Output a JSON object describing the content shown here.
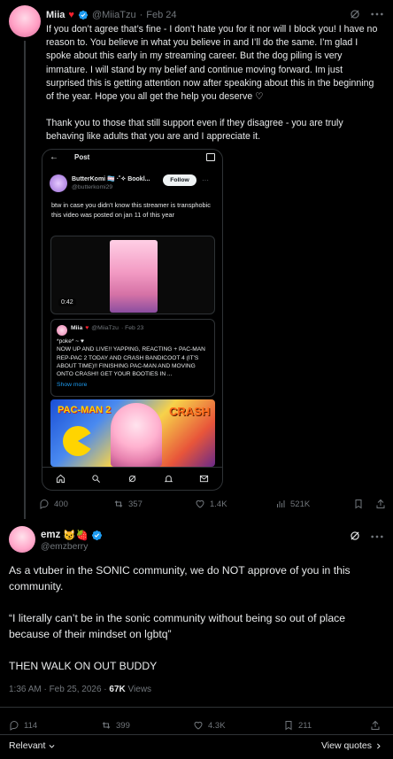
{
  "post1": {
    "name": "Miia",
    "heart": "♥",
    "handle": "@MiiaTzu",
    "sep": "·",
    "date": "Feb 24",
    "paragraph1": "If you don’t agree that’s fine - I don’t hate you for it nor will I block you! I have no reason to. You believe in what you believe in and I’ll do the same. I’m glad I spoke about this early in my streaming career. But the dog piling is very immature. I will stand by my belief and continue moving forward. Im just surprised this is getting attention now after speaking about this in the beginning of the year. Hope you all get the help you deserve ♡",
    "paragraph2": "Thank you to those that still support even if they disagree - you are truly behaving like adults that you are and I appreciate it.",
    "actions": {
      "replies": "400",
      "reposts": "357",
      "likes": "1.4K",
      "views": "521K"
    }
  },
  "screenshot": {
    "back": "←",
    "title": "Post",
    "author_name": "ButterKomi 🏳️‍⚧️ ·˚✧ Bookl...",
    "author_handle": "@butterkomi29",
    "follow_label": "Follow",
    "more": "···",
    "text": "btw in case you didn't know this streamer is transphobic\nthis video was posted on jan 11 of this year",
    "video_time": "0:42",
    "quoted": {
      "name": "Miia",
      "heart": "♥",
      "handle": "@MiiaTzu",
      "date": "· Feb 23",
      "text": "*poke* ~ ♥\nNOW UP AND LIVE!! YAPPING, REACTING + PAC-MAN REP-PAC 2 TODAY AND CRASH BANDICOOT 4 (IT'S ABOUT TIME)!! FINISHING PAC-MAN AND MOVING ONTO CRASH!! GET YOUR BOOTIES IN ...",
      "show_more": "Show more"
    },
    "game_title_left": "PAC-MAN 2",
    "game_title_right": "CRASH"
  },
  "post2": {
    "name": "emz",
    "emojis": "😼🍓",
    "handle": "@emzberry",
    "body": [
      "As a vtuber in the SONIC community, we do NOT approve of you in this community.",
      "“I literally can’t be in the sonic community without being so out of place because of their mindset on lgbtq”",
      "THEN WALK ON OUT BUDDY"
    ],
    "time": "1:36 AM · Feb 25, 2026 · ",
    "views_count": "67K",
    "views_label": " Views",
    "actions": {
      "replies": "114",
      "reposts": "399",
      "likes": "4.3K",
      "bookmarks": "211"
    },
    "relevant_label": "Relevant",
    "view_quotes_label": "View quotes"
  },
  "colors": {
    "accent": "#1d9bf0",
    "bg": "#000000",
    "text": "#e7e9ea",
    "muted": "#71767b",
    "heart": "#f4212e"
  }
}
